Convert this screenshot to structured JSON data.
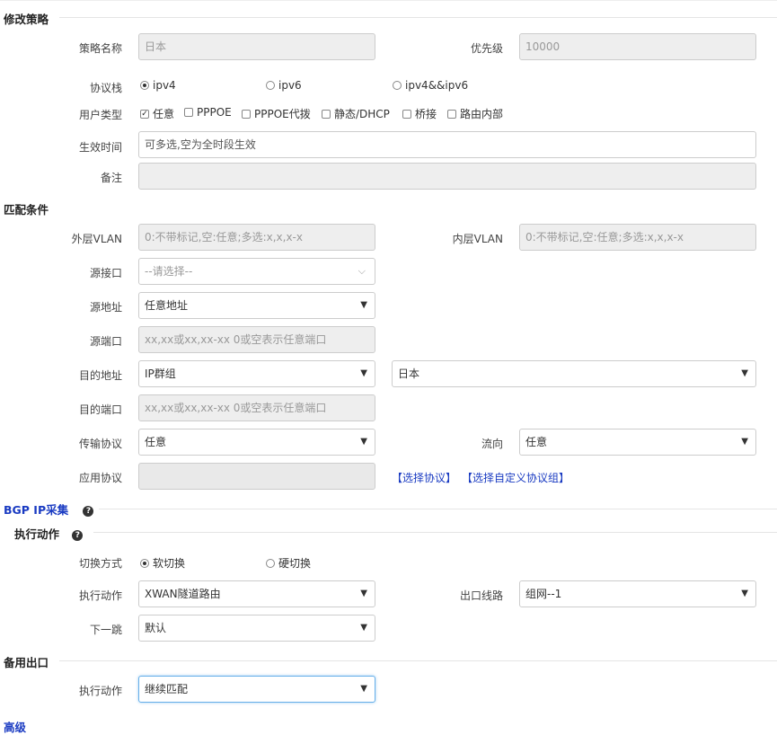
{
  "sections": {
    "modify": "修改策略",
    "match": "匹配条件",
    "bgp": "BGP IP采集",
    "action": "执行动作",
    "backup": "备用出口",
    "advanced": "高级"
  },
  "fields": {
    "name": {
      "label": "策略名称",
      "value": "日本"
    },
    "priority": {
      "label": "优先级",
      "value": "10000"
    },
    "protocol_stack": {
      "label": "协议栈",
      "options": [
        "ipv4",
        "ipv6",
        "ipv4&&ipv6"
      ],
      "selected": "ipv4"
    },
    "user_type": {
      "label": "用户类型",
      "options": [
        {
          "label": "任意",
          "checked": true
        },
        {
          "label": "PPPOE",
          "checked": false
        },
        {
          "label": "PPPOE代拨",
          "checked": false
        },
        {
          "label": "静态/DHCP",
          "checked": false
        },
        {
          "label": "桥接",
          "checked": false
        },
        {
          "label": "路由内部",
          "checked": false
        }
      ]
    },
    "effective_time": {
      "label": "生效时间",
      "value": "可多选,空为全时段生效"
    },
    "remark": {
      "label": "备注",
      "value": ""
    },
    "outer_vlan": {
      "label": "外层VLAN",
      "placeholder": "0:不带标记,空:任意;多选:x,x,x-x"
    },
    "inner_vlan": {
      "label": "内层VLAN",
      "placeholder": "0:不带标记,空:任意;多选:x,x,x-x"
    },
    "src_interface": {
      "label": "源接口",
      "placeholder": "--请选择--"
    },
    "src_addr": {
      "label": "源地址",
      "value": "任意地址"
    },
    "src_port": {
      "label": "源端口",
      "placeholder": "xx,xx或xx,xx-xx 0或空表示任意端口"
    },
    "dst_addr": {
      "label": "目的地址",
      "value": "IP群组",
      "group": "日本"
    },
    "dst_port": {
      "label": "目的端口",
      "placeholder": "xx,xx或xx,xx-xx 0或空表示任意端口"
    },
    "transport": {
      "label": "传输协议",
      "value": "任意"
    },
    "direction": {
      "label": "流向",
      "value": "任意"
    },
    "app_protocol": {
      "label": "应用协议",
      "value": "",
      "link1": "【选择协议】",
      "link2": "【选择自定义协议组】"
    },
    "switch_mode": {
      "label": "切换方式",
      "options": [
        "软切换",
        "硬切换"
      ],
      "selected": "软切换"
    },
    "exec_action": {
      "label": "执行动作",
      "value": "XWAN隧道路由"
    },
    "exit_line": {
      "label": "出口线路",
      "value": "组网--1"
    },
    "next_hop": {
      "label": "下一跳",
      "value": "默认"
    },
    "backup_action": {
      "label": "执行动作",
      "value": "继续匹配"
    }
  },
  "icons": {
    "help": "question-circle-icon",
    "select_caret": "caret-down-icon",
    "chevron": "chevron-down-icon"
  },
  "colors": {
    "link": "#1a3bc2",
    "bgp_title": "#1a3bc2",
    "readonly_bg": "#eeeeee",
    "border": "#cccccc",
    "focus": "#66afe9"
  }
}
